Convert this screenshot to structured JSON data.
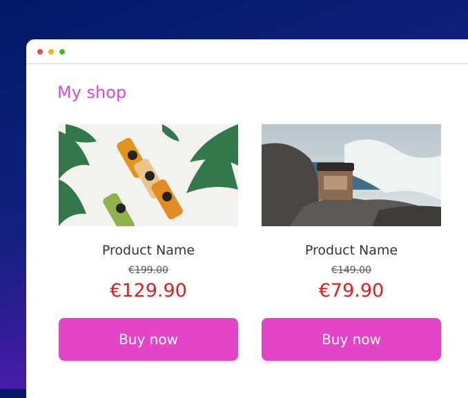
{
  "shop": {
    "title": "My shop"
  },
  "products": [
    {
      "name": "Product Name",
      "old_price": "€199.00",
      "price": "€129.90",
      "button": "Buy now",
      "image": "juice-bottles-photo"
    },
    {
      "name": "Product Name",
      "old_price": "€149.00",
      "price": "€79.90",
      "button": "Buy now",
      "image": "jar-on-rock-photo"
    }
  ],
  "colors": {
    "accent": "#e444c8",
    "title": "#d94ad0",
    "price": "#e31b1b"
  }
}
